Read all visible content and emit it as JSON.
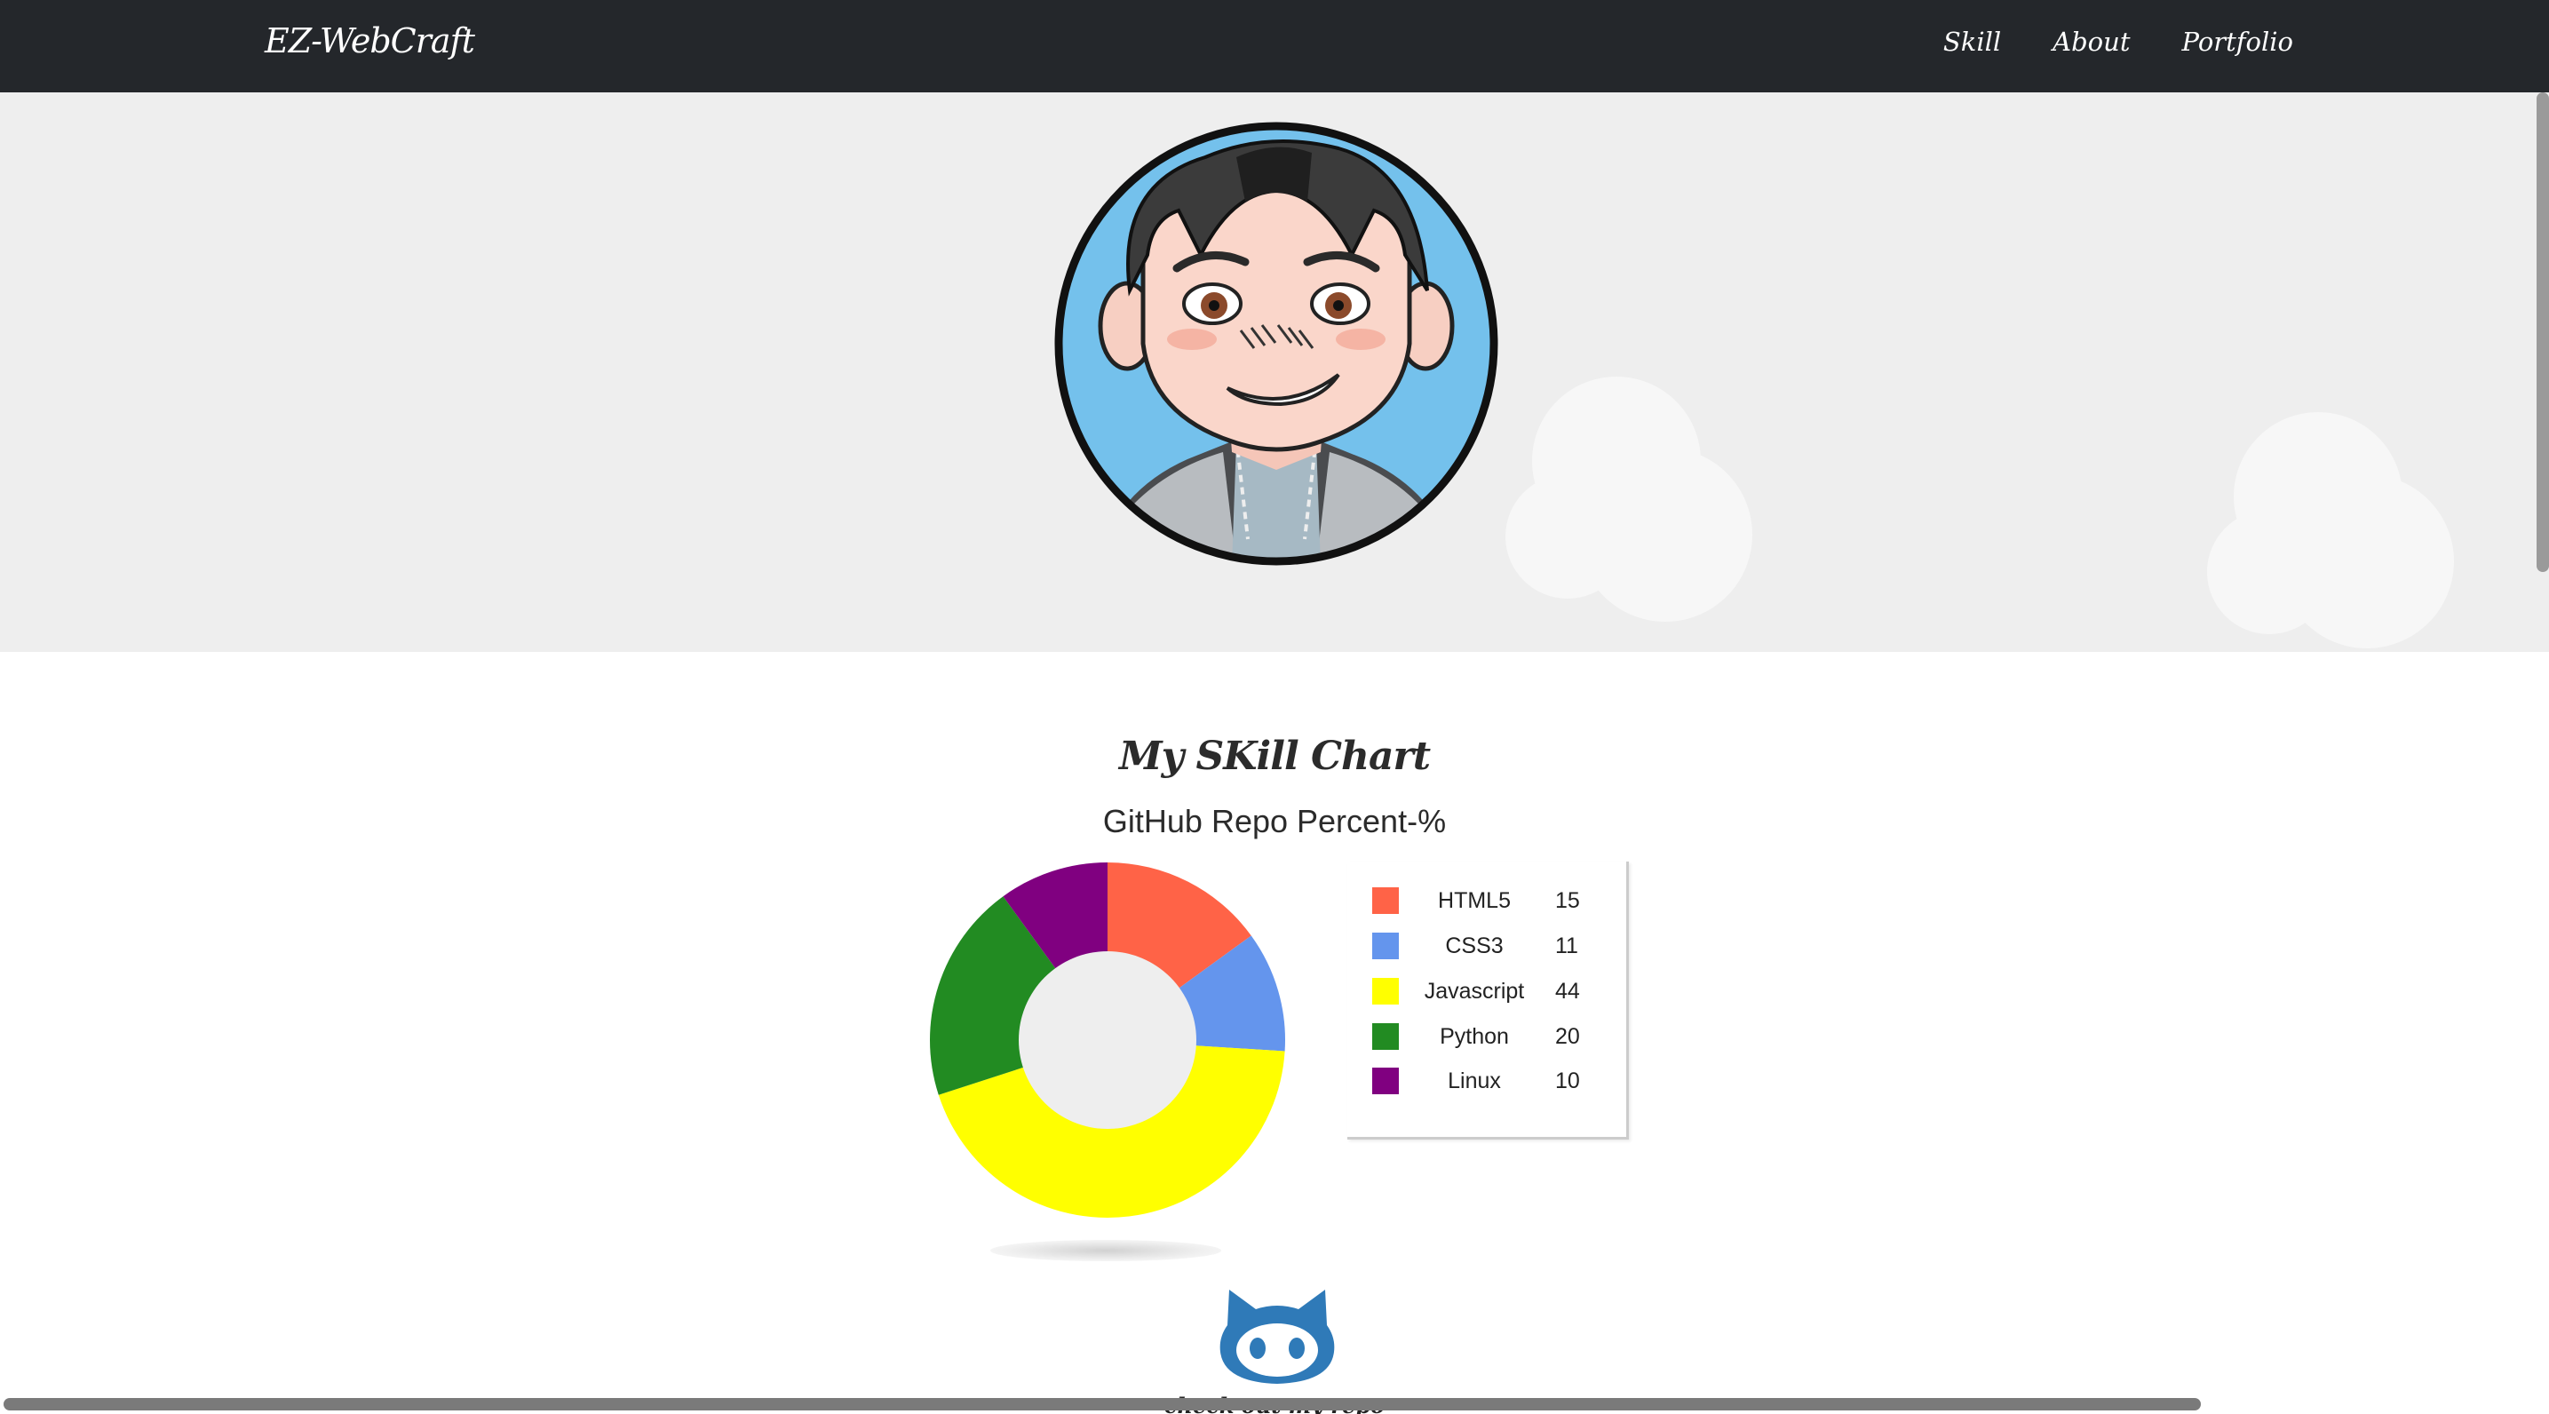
{
  "navbar": {
    "brand": "EZ-WebCraft",
    "links": [
      "Skill",
      "About",
      "Portfolio"
    ]
  },
  "hero": {
    "avatar": "cartoon-avatar-portrait"
  },
  "skills": {
    "heading": "My SKill Chart",
    "chart_title": "GitHub Repo Percent-%",
    "repo_link_text": "check out my repo"
  },
  "colors": {
    "navbar_bg": "#24272b",
    "hero_bg": "#eeeeee",
    "html5": "#ff6347",
    "css3": "#6495ed",
    "javascript": "#ffff00",
    "python": "#228b22",
    "linux": "#800080",
    "github_blue": "#2f7ab8"
  },
  "chart_data": {
    "type": "pie",
    "title": "GitHub Repo Percent-%",
    "categories": [
      "HTML5",
      "CSS3",
      "Javascript",
      "Python",
      "Linux"
    ],
    "values": [
      15,
      11,
      44,
      20,
      10
    ],
    "colors": [
      "#ff6347",
      "#6495ed",
      "#ffff00",
      "#228b22",
      "#800080"
    ],
    "donut": true,
    "legend": "right"
  }
}
